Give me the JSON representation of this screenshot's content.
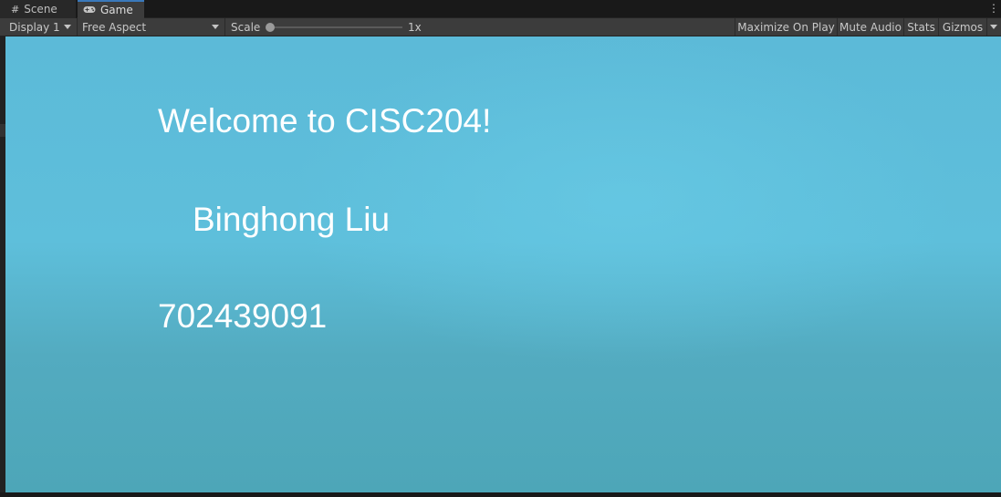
{
  "tabs": {
    "scene": {
      "label": "Scene",
      "icon": "grid-icon"
    },
    "game": {
      "label": "Game",
      "icon": "gamepad-icon"
    }
  },
  "toolbar": {
    "display": "Display 1",
    "aspect": "Free Aspect",
    "scale_label": "Scale",
    "scale_value": "1x",
    "scale_level": 0,
    "maximize": "Maximize On Play",
    "mute": "Mute Audio",
    "stats": "Stats",
    "gizmos": "Gizmos"
  },
  "game": {
    "welcome": "Welcome to CISC204!",
    "name": "Binghong Liu",
    "id": "702439091"
  },
  "colors": {
    "sky_top": "#5cbad8",
    "sky_bottom": "#4da6b8",
    "active_tab_accent": "#3a79bb"
  }
}
